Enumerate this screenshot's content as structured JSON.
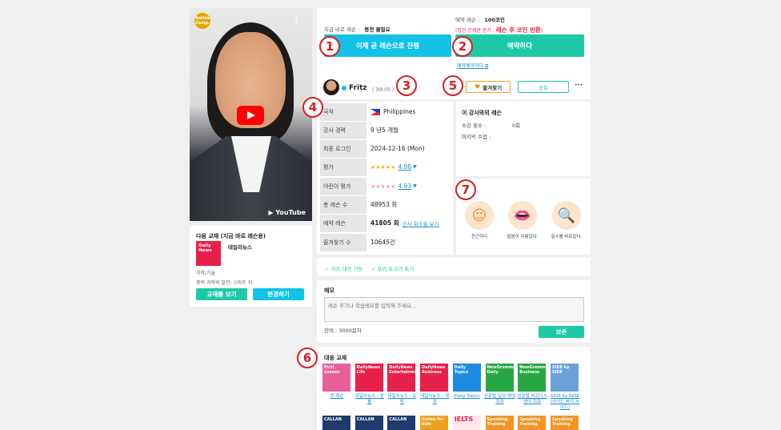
{
  "video": {
    "logo": "Native Camp.",
    "brand": "YouTube"
  },
  "next_textbook": {
    "title": "다음 교재 (지금 바로 레슨용)",
    "book_cover": "Daily News",
    "book_name": "데일리뉴스",
    "category": "과학/기술",
    "lesson": "중력 과학의 발전: 스마트 허",
    "btn_view": "교재를 보기",
    "btn_change": "변경하기"
  },
  "booking": {
    "instant_label": "지금 바로 레슨 :",
    "instant_value": "동전 불필요",
    "reserve_label": "예약 레슨 :",
    "reserve_value": "100코인",
    "refund_note": "(집간 무제한 받기 :",
    "refund_highlight": "레슨 후 코인 반환",
    "refund_close": ")",
    "btn_now": "이제 곧 레슨으로 진행",
    "btn_reserve": "예약하다",
    "reserve_calendar": "예약예약하다"
  },
  "tutor": {
    "name": "Fritz",
    "age": "( 30나이 )",
    "fav_button": "즐겨찾기",
    "share_button": "공유",
    "more": "···"
  },
  "profile_table": [
    {
      "key": "국적",
      "value": "Philippines"
    },
    {
      "key": "강사 경력",
      "value": "9 년5 개월"
    },
    {
      "key": "최종 로그인",
      "value": "2024-12-16 (Mon)"
    },
    {
      "key": "평가",
      "value": "4.98"
    },
    {
      "key": "어린이 평가",
      "value": "4.93"
    },
    {
      "key": "총 레슨 수",
      "value": "48953 회"
    },
    {
      "key": "예약 레슨",
      "value": "41805 회",
      "link": "강사 취소율 보기"
    },
    {
      "key": "즐겨찾기 수",
      "value": "10645건"
    }
  ],
  "ratings": {
    "stars": "★★★★★",
    "adult": 4.98,
    "kids": 4.93
  },
  "history": {
    "title": "이 강사와의 레슨",
    "count_label": "수강 횟수 :",
    "count_value": "0회",
    "last_label": "마지막 수업 :",
    "last_value": ""
  },
  "traits": [
    {
      "icon": "friendly-icon",
      "label": "친근하다."
    },
    {
      "icon": "pronunciation-icon",
      "label": "발음이 아름답다."
    },
    {
      "icon": "correction-icon",
      "label": "실수를 바로잡다."
    }
  ],
  "tags": [
    "✓ 키즈 대응 가능",
    "✓ 프리 토크가 특기"
  ],
  "memo": {
    "title": "메모",
    "placeholder": "레슨 후기나 학습메모를 입력해 주세요...",
    "remaining": "잔여 : 3000문자",
    "save": "보존"
  },
  "textbooks": {
    "title": "대응 교재",
    "row1": [
      {
        "cover": "First Lesson",
        "label": "첫 레슨",
        "color": "#e85f9a"
      },
      {
        "cover": "DailyNews Life",
        "label": "데일리뉴스 - 생활",
        "color": "#e8214a"
      },
      {
        "cover": "DailyNews Entertainment",
        "label": "데일리뉴스 - 오락",
        "color": "#e8214a"
      },
      {
        "cover": "DailyNews Business",
        "label": "데일리뉴스 - 재경",
        "color": "#e8214a"
      },
      {
        "cover": "Daily Topics",
        "label": "Daily Topics",
        "color": "#1f8be0"
      },
      {
        "cover": "NewGrammar Daily",
        "label": "신문법 일상 영어 회화",
        "color": "#28a745"
      },
      {
        "cover": "NewGrammar Business",
        "label": "신문법 비즈니스 영어 회화",
        "color": "#28a745"
      },
      {
        "cover": "SIDE by SIDE",
        "label": "SIDE by SIDE (사이드 바이 사이드)",
        "color": "#6aa2d8"
      }
    ],
    "row2": [
      {
        "cover": "CALLAN",
        "color": "#1e3a6a"
      },
      {
        "cover": "CALLAN",
        "color": "#1e3a6a"
      },
      {
        "cover": "CALLAN",
        "color": "#1e3a6a"
      },
      {
        "cover": "Callan for kids",
        "color": "#f0a020"
      },
      {
        "cover": "IELTS",
        "color": "#fce8ea"
      },
      {
        "cover": "Speaking Training",
        "color": "#f39423"
      },
      {
        "cover": "Speaking Training",
        "color": "#f39423"
      },
      {
        "cover": "Speaking Training",
        "color": "#f39423"
      }
    ]
  },
  "markers": [
    "1",
    "2",
    "3",
    "4",
    "5",
    "6",
    "7"
  ]
}
